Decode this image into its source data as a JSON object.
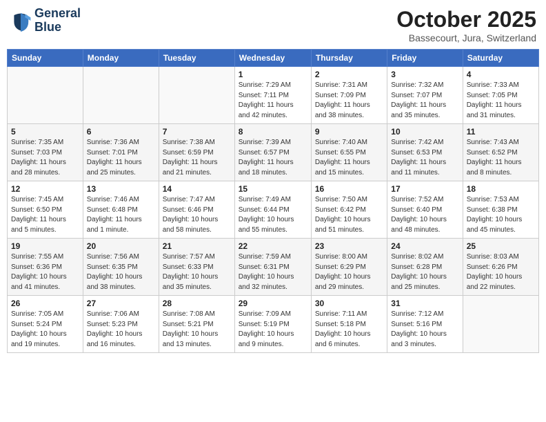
{
  "logo": {
    "line1": "General",
    "line2": "Blue"
  },
  "header": {
    "month": "October 2025",
    "location": "Bassecourt, Jura, Switzerland"
  },
  "weekdays": [
    "Sunday",
    "Monday",
    "Tuesday",
    "Wednesday",
    "Thursday",
    "Friday",
    "Saturday"
  ],
  "weeks": [
    [
      {
        "day": "",
        "info": ""
      },
      {
        "day": "",
        "info": ""
      },
      {
        "day": "",
        "info": ""
      },
      {
        "day": "1",
        "info": "Sunrise: 7:29 AM\nSunset: 7:11 PM\nDaylight: 11 hours\nand 42 minutes."
      },
      {
        "day": "2",
        "info": "Sunrise: 7:31 AM\nSunset: 7:09 PM\nDaylight: 11 hours\nand 38 minutes."
      },
      {
        "day": "3",
        "info": "Sunrise: 7:32 AM\nSunset: 7:07 PM\nDaylight: 11 hours\nand 35 minutes."
      },
      {
        "day": "4",
        "info": "Sunrise: 7:33 AM\nSunset: 7:05 PM\nDaylight: 11 hours\nand 31 minutes."
      }
    ],
    [
      {
        "day": "5",
        "info": "Sunrise: 7:35 AM\nSunset: 7:03 PM\nDaylight: 11 hours\nand 28 minutes."
      },
      {
        "day": "6",
        "info": "Sunrise: 7:36 AM\nSunset: 7:01 PM\nDaylight: 11 hours\nand 25 minutes."
      },
      {
        "day": "7",
        "info": "Sunrise: 7:38 AM\nSunset: 6:59 PM\nDaylight: 11 hours\nand 21 minutes."
      },
      {
        "day": "8",
        "info": "Sunrise: 7:39 AM\nSunset: 6:57 PM\nDaylight: 11 hours\nand 18 minutes."
      },
      {
        "day": "9",
        "info": "Sunrise: 7:40 AM\nSunset: 6:55 PM\nDaylight: 11 hours\nand 15 minutes."
      },
      {
        "day": "10",
        "info": "Sunrise: 7:42 AM\nSunset: 6:53 PM\nDaylight: 11 hours\nand 11 minutes."
      },
      {
        "day": "11",
        "info": "Sunrise: 7:43 AM\nSunset: 6:52 PM\nDaylight: 11 hours\nand 8 minutes."
      }
    ],
    [
      {
        "day": "12",
        "info": "Sunrise: 7:45 AM\nSunset: 6:50 PM\nDaylight: 11 hours\nand 5 minutes."
      },
      {
        "day": "13",
        "info": "Sunrise: 7:46 AM\nSunset: 6:48 PM\nDaylight: 11 hours\nand 1 minute."
      },
      {
        "day": "14",
        "info": "Sunrise: 7:47 AM\nSunset: 6:46 PM\nDaylight: 10 hours\nand 58 minutes."
      },
      {
        "day": "15",
        "info": "Sunrise: 7:49 AM\nSunset: 6:44 PM\nDaylight: 10 hours\nand 55 minutes."
      },
      {
        "day": "16",
        "info": "Sunrise: 7:50 AM\nSunset: 6:42 PM\nDaylight: 10 hours\nand 51 minutes."
      },
      {
        "day": "17",
        "info": "Sunrise: 7:52 AM\nSunset: 6:40 PM\nDaylight: 10 hours\nand 48 minutes."
      },
      {
        "day": "18",
        "info": "Sunrise: 7:53 AM\nSunset: 6:38 PM\nDaylight: 10 hours\nand 45 minutes."
      }
    ],
    [
      {
        "day": "19",
        "info": "Sunrise: 7:55 AM\nSunset: 6:36 PM\nDaylight: 10 hours\nand 41 minutes."
      },
      {
        "day": "20",
        "info": "Sunrise: 7:56 AM\nSunset: 6:35 PM\nDaylight: 10 hours\nand 38 minutes."
      },
      {
        "day": "21",
        "info": "Sunrise: 7:57 AM\nSunset: 6:33 PM\nDaylight: 10 hours\nand 35 minutes."
      },
      {
        "day": "22",
        "info": "Sunrise: 7:59 AM\nSunset: 6:31 PM\nDaylight: 10 hours\nand 32 minutes."
      },
      {
        "day": "23",
        "info": "Sunrise: 8:00 AM\nSunset: 6:29 PM\nDaylight: 10 hours\nand 29 minutes."
      },
      {
        "day": "24",
        "info": "Sunrise: 8:02 AM\nSunset: 6:28 PM\nDaylight: 10 hours\nand 25 minutes."
      },
      {
        "day": "25",
        "info": "Sunrise: 8:03 AM\nSunset: 6:26 PM\nDaylight: 10 hours\nand 22 minutes."
      }
    ],
    [
      {
        "day": "26",
        "info": "Sunrise: 7:05 AM\nSunset: 5:24 PM\nDaylight: 10 hours\nand 19 minutes."
      },
      {
        "day": "27",
        "info": "Sunrise: 7:06 AM\nSunset: 5:23 PM\nDaylight: 10 hours\nand 16 minutes."
      },
      {
        "day": "28",
        "info": "Sunrise: 7:08 AM\nSunset: 5:21 PM\nDaylight: 10 hours\nand 13 minutes."
      },
      {
        "day": "29",
        "info": "Sunrise: 7:09 AM\nSunset: 5:19 PM\nDaylight: 10 hours\nand 9 minutes."
      },
      {
        "day": "30",
        "info": "Sunrise: 7:11 AM\nSunset: 5:18 PM\nDaylight: 10 hours\nand 6 minutes."
      },
      {
        "day": "31",
        "info": "Sunrise: 7:12 AM\nSunset: 5:16 PM\nDaylight: 10 hours\nand 3 minutes."
      },
      {
        "day": "",
        "info": ""
      }
    ]
  ]
}
